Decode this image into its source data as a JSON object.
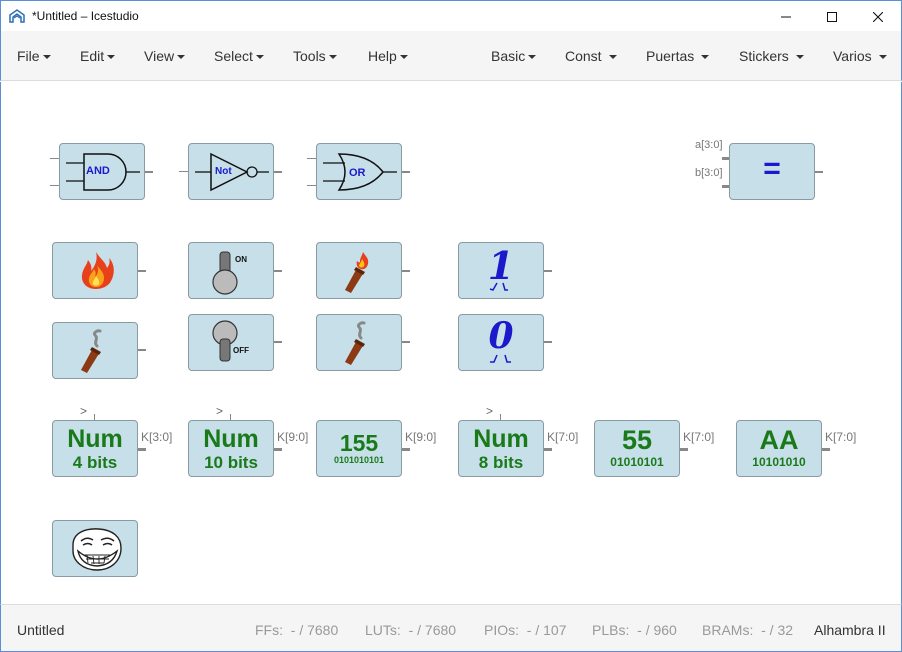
{
  "window": {
    "title": "*Untitled – Icestudio"
  },
  "menu_left": [
    {
      "label": "File"
    },
    {
      "label": "Edit"
    },
    {
      "label": "View"
    },
    {
      "label": "Select"
    },
    {
      "label": "Tools"
    },
    {
      "label": "Help"
    }
  ],
  "menu_right": [
    {
      "label": "Basic"
    },
    {
      "label": "Const"
    },
    {
      "label": "Puertas"
    },
    {
      "label": "Stickers"
    },
    {
      "label": "Varios"
    }
  ],
  "blocks": {
    "and": {
      "text": "AND"
    },
    "not": {
      "text": "Not"
    },
    "or": {
      "text": "OR"
    },
    "compare": {
      "text": "=",
      "input_a": "a[3:0]",
      "input_b": "b[3:0]"
    },
    "toggle_on": {
      "text": "ON"
    },
    "toggle_off": {
      "text": "OFF"
    },
    "one": {
      "text": "1"
    },
    "zero": {
      "text": "0"
    },
    "num4": {
      "line1": "Num",
      "line2": "4 bits",
      "port": "K[3:0]",
      "clk": ">"
    },
    "num10": {
      "line1": "Num",
      "line2": "10 bits",
      "port": "K[9:0]",
      "clk": ">"
    },
    "const155": {
      "line1": "155",
      "line2": "0101010101",
      "port": "K[9:0]"
    },
    "num8": {
      "line1": "Num",
      "line2": "8 bits",
      "port": "K[7:0]",
      "clk": ">"
    },
    "const55": {
      "line1": "55",
      "line2": "01010101",
      "port": "K[7:0]"
    },
    "constAA": {
      "line1": "AA",
      "line2": "10101010",
      "port": "K[7:0]"
    }
  },
  "status": {
    "file": "Untitled",
    "ffs_label": "FFs:",
    "ffs_value": "- / 7680",
    "luts_label": "LUTs:",
    "luts_value": "- / 7680",
    "pios_label": "PIOs:",
    "pios_value": "- / 107",
    "plbs_label": "PLBs:",
    "plbs_value": "- / 960",
    "brams_label": "BRAMs:",
    "brams_value": "- / 32",
    "board": "Alhambra II"
  },
  "colors": {
    "block_fill": "#c6dfe9",
    "num_green": "#1a7a1a",
    "gate_blue": "#1a1acc"
  },
  "icons": [
    "app-logo-icon",
    "minimize-icon",
    "maximize-icon",
    "close-icon",
    "fire-icon",
    "torch-lit-icon",
    "torch-off-icon",
    "switch-on-icon",
    "switch-off-icon",
    "troll-face-icon"
  ]
}
